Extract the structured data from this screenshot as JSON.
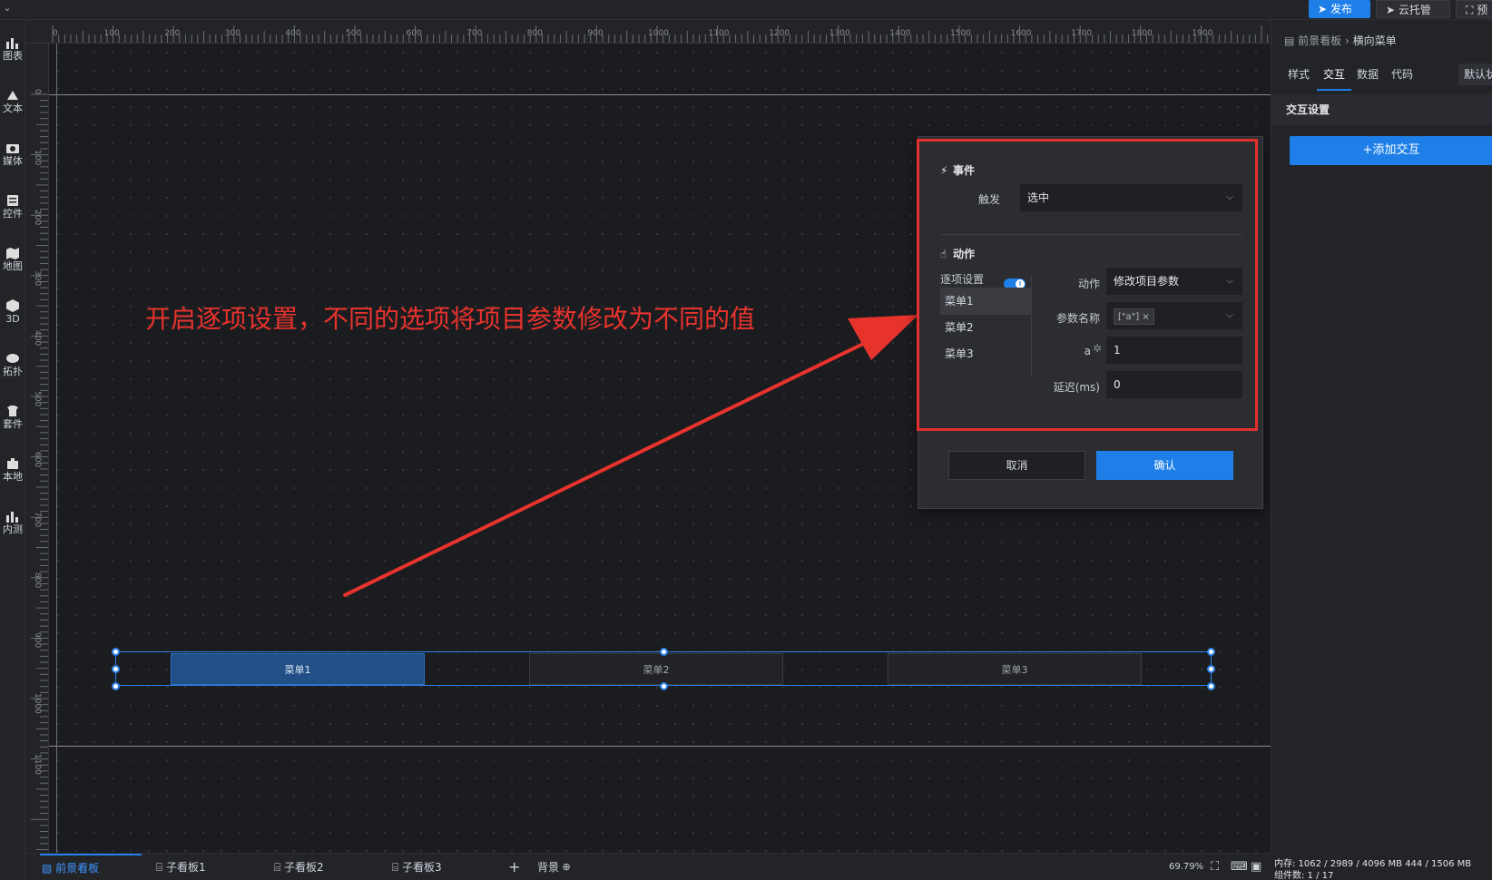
{
  "topbar": {
    "publish": "发布",
    "cloud": "云托管",
    "preview": "预"
  },
  "sidebar": {
    "items": [
      {
        "label": "图表",
        "icon": "chart-icon"
      },
      {
        "label": "文本",
        "icon": "text-icon"
      },
      {
        "label": "媒体",
        "icon": "media-icon"
      },
      {
        "label": "控件",
        "icon": "widget-icon"
      },
      {
        "label": "地图",
        "icon": "map-icon"
      },
      {
        "label": "3D",
        "icon": "cube-icon"
      },
      {
        "label": "拓扑",
        "icon": "topology-icon"
      },
      {
        "label": "套件",
        "icon": "suite-icon"
      },
      {
        "label": "本地",
        "icon": "local-icon"
      },
      {
        "label": "内测",
        "icon": "beta-icon"
      }
    ]
  },
  "ruler": {
    "top_labels": [
      "0",
      "100",
      "200",
      "300",
      "400",
      "500",
      "600",
      "700",
      "800",
      "900",
      "1000",
      "1100",
      "1200",
      "1300",
      "1400",
      "1500",
      "1600",
      "1700",
      "1800",
      "1900"
    ],
    "left_labels": [
      "0",
      "100",
      "200",
      "300",
      "400",
      "500",
      "600",
      "700",
      "800",
      "900",
      "1000",
      "1100"
    ]
  },
  "annotation": "开启逐项设置，不同的选项将项目参数修改为不同的值",
  "menu_component": {
    "items": [
      "菜单1",
      "菜单2",
      "菜单3"
    ],
    "active_index": 0
  },
  "dialog": {
    "event_title": "事件",
    "trigger_label": "触发",
    "trigger_value": "选中",
    "action_title": "动作",
    "per_item_label": "逐项设置",
    "per_item_enabled": true,
    "items": [
      "菜单1",
      "菜单2",
      "菜单3"
    ],
    "selected_item": "菜单1",
    "action_label": "动作",
    "action_value": "修改项目参数",
    "param_name_label": "参数名称",
    "param_tag": "[\"a\"]",
    "param_a_label": "a",
    "param_a_value": "1",
    "delay_label": "延迟(ms)",
    "delay_value": "0",
    "cancel": "取消",
    "confirm": "确认"
  },
  "right_panel": {
    "breadcrumb_root": "前景看板",
    "breadcrumb_current": "横向菜单",
    "tabs": [
      "样式",
      "交互",
      "数据",
      "代码"
    ],
    "active_tab": "交互",
    "default_btn": "默认状",
    "section": "交互设置",
    "add_button": "+添加交互"
  },
  "bottom": {
    "tabs": [
      "前景看板",
      "子看板1",
      "子看板2",
      "子看板3"
    ],
    "active_tab": "前景看板",
    "add": "+",
    "background": "背景",
    "zoom": "69.79%",
    "memory": "内存: 1062 / 2989 / 4096 MB  444 / 1506 MB",
    "component_count": "组件数: 1 / 17"
  }
}
